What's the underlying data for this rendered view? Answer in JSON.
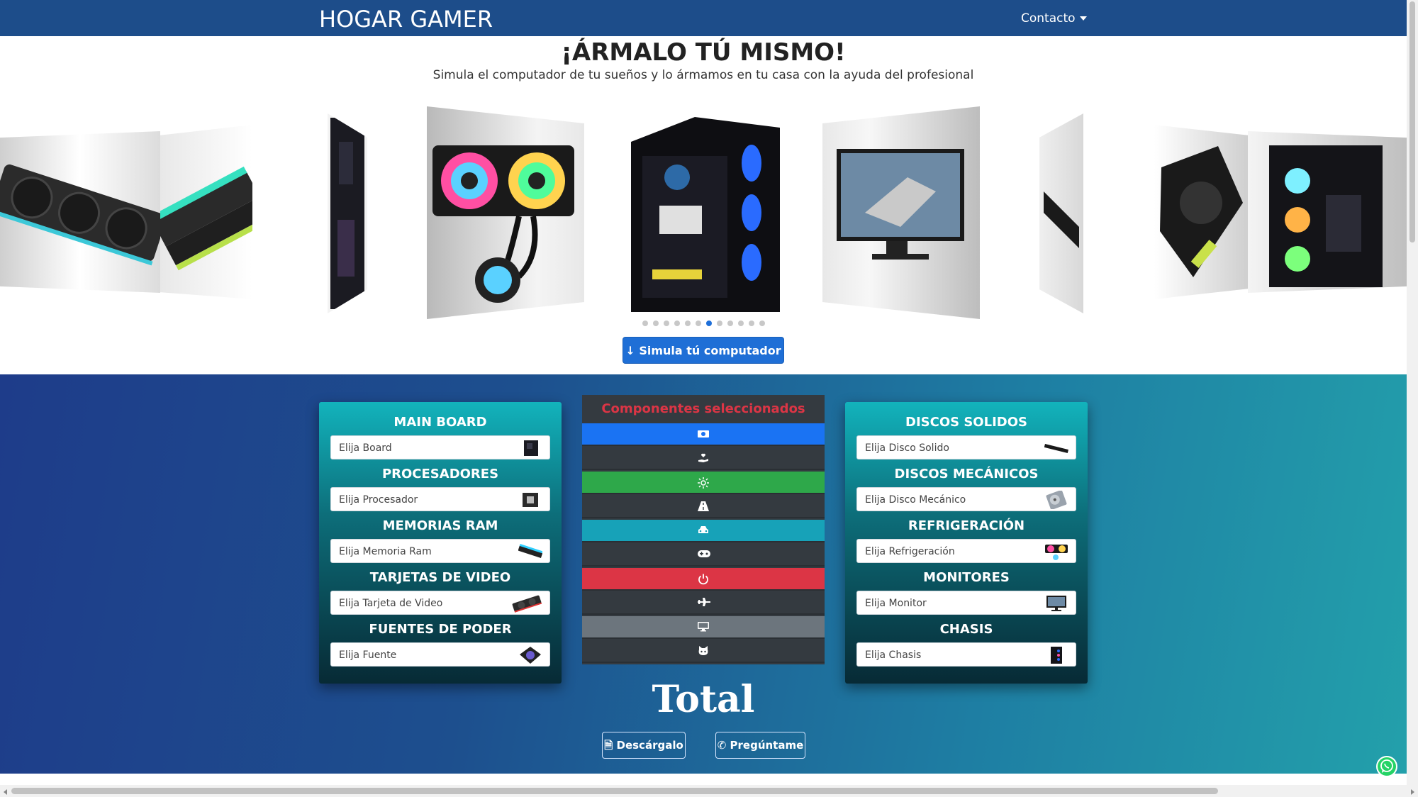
{
  "navbar": {
    "brand": "HOGAR GAMER",
    "contact": "Contacto"
  },
  "hero": {
    "title": "¡ÁRMALO TÚ MISMO!",
    "subtitle": "Simula el computador de tu sueños y lo ármamos en tu casa con la ayuda del profesional"
  },
  "carousel": {
    "slide_count": 12,
    "active_index": 6
  },
  "cta": {
    "simulate": "Simula tú computador"
  },
  "left_card": {
    "sections": [
      {
        "title": "MAIN BOARD",
        "placeholder": "Elija Board",
        "icon": "motherboard-icon"
      },
      {
        "title": "PROCESADORES",
        "placeholder": "Elija Procesador",
        "icon": "cpu-icon"
      },
      {
        "title": "MEMORIAS RAM",
        "placeholder": "Elija Memoria Ram",
        "icon": "ram-icon"
      },
      {
        "title": "TARJETAS DE VIDEO",
        "placeholder": "Elija Tarjeta de Video",
        "icon": "gpu-icon"
      },
      {
        "title": "FUENTES DE PODER",
        "placeholder": "Elija Fuente",
        "icon": "psu-icon"
      }
    ]
  },
  "right_card": {
    "sections": [
      {
        "title": "DISCOS SOLIDOS",
        "placeholder": "Elija Disco Solido",
        "icon": "ssd-icon"
      },
      {
        "title": "DISCOS MECÁNICOS",
        "placeholder": "Elija Disco Mecánico",
        "icon": "hdd-icon"
      },
      {
        "title": "REFRIGERACIÓN",
        "placeholder": "Elija Refrigeración",
        "icon": "cooler-icon"
      },
      {
        "title": "MONITORES",
        "placeholder": "Elija Monitor",
        "icon": "monitor-icon"
      },
      {
        "title": "CHASIS",
        "placeholder": "Elija Chasis",
        "icon": "chassis-icon"
      }
    ]
  },
  "selected": {
    "title": "Componentes seleccionados",
    "rows": [
      {
        "icon": "money-icon",
        "color": "#1a73f3"
      },
      {
        "icon": "hand-heart-icon",
        "color": "#343a40"
      },
      {
        "icon": "sun-icon",
        "color": "#2ea84a"
      },
      {
        "icon": "road-icon",
        "color": "#343a40"
      },
      {
        "icon": "car-icon",
        "color": "#17a2b8"
      },
      {
        "icon": "gamepad-icon",
        "color": "#343a40"
      },
      {
        "icon": "power-icon",
        "color": "#dc3545"
      },
      {
        "icon": "plane-icon",
        "color": "#343a40"
      },
      {
        "icon": "desktop-icon",
        "color": "#6c757d"
      },
      {
        "icon": "github-icon",
        "color": "#343a40"
      }
    ]
  },
  "total": {
    "label": "Total"
  },
  "actions": {
    "download": "Descárgalo",
    "ask": "Pregúntame"
  },
  "colors": {
    "navbar": "#1d4d8a",
    "accent_blue": "#1f6fd6",
    "selected_title": "#dc3545"
  }
}
